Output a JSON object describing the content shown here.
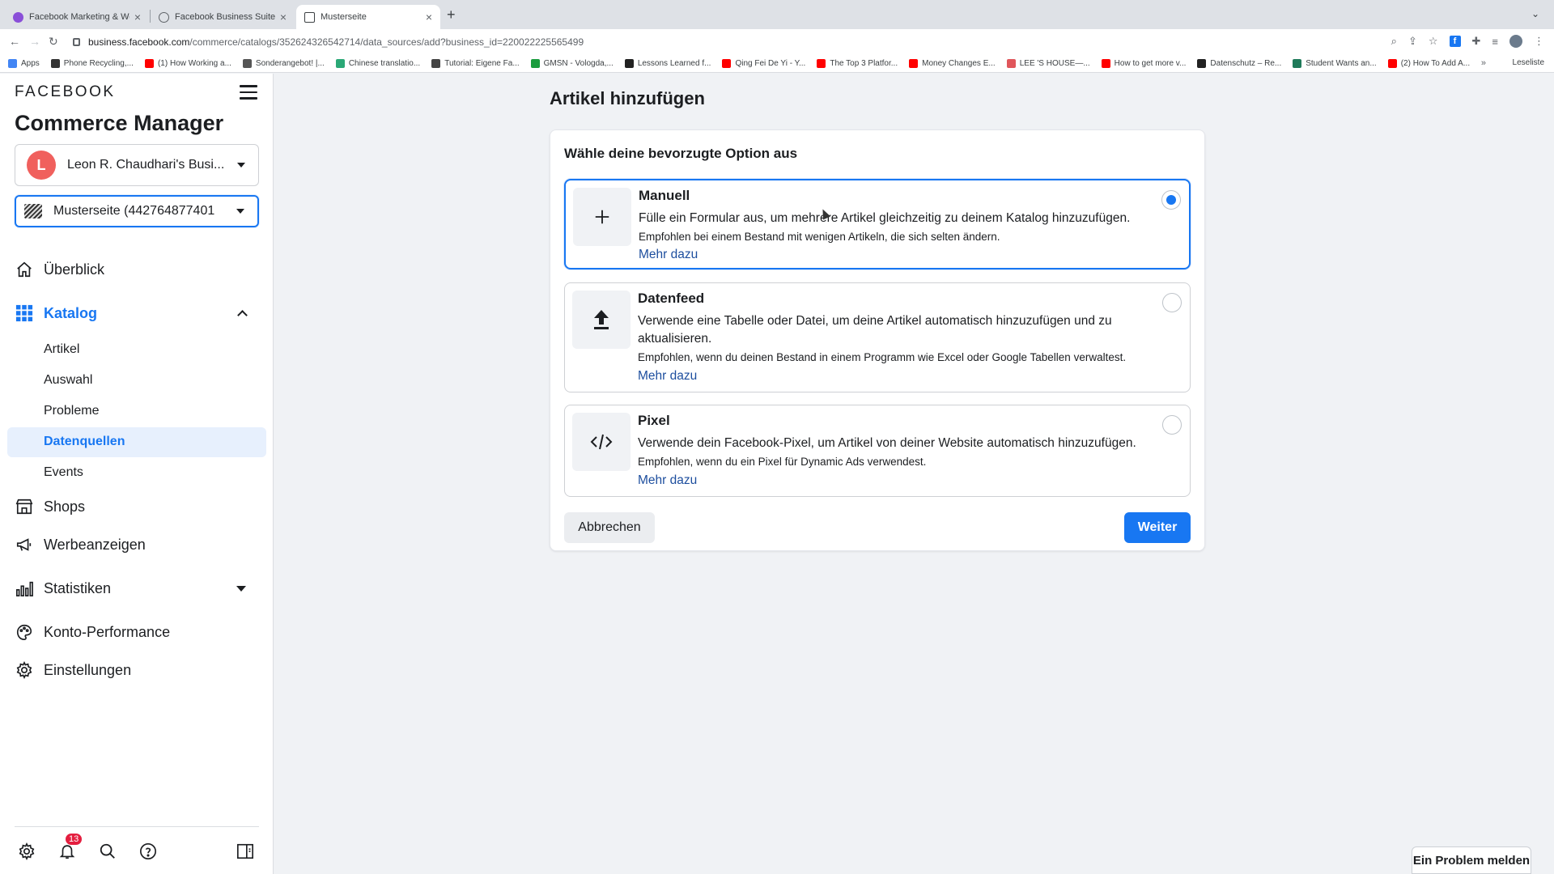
{
  "browser": {
    "tabs": [
      {
        "title": "Facebook Marketing & Werbe",
        "color": "#8a4fd8"
      },
      {
        "title": "Facebook Business Suite",
        "color": "#5f6368"
      },
      {
        "title": "Musterseite",
        "color": "#3c4043"
      }
    ],
    "url_host": "business.facebook.com",
    "url_path": "/commerce/catalogs/352624326542714/data_sources/add?business_id=220022225565499",
    "bookmarks": [
      {
        "label": "Apps",
        "color": "#4285f4"
      },
      {
        "label": "Phone Recycling,...",
        "color": "#333333"
      },
      {
        "label": "(1) How Working a...",
        "color": "#ff0000"
      },
      {
        "label": "Sonderangebot! |...",
        "color": "#555555"
      },
      {
        "label": "Chinese translatio...",
        "color": "#2aa876"
      },
      {
        "label": "Tutorial: Eigene Fa...",
        "color": "#444444"
      },
      {
        "label": "GMSN - Vologda,...",
        "color": "#1a9c3e"
      },
      {
        "label": "Lessons Learned f...",
        "color": "#222222"
      },
      {
        "label": "Qing Fei De Yi - Y...",
        "color": "#ff0000"
      },
      {
        "label": "The Top 3 Platfor...",
        "color": "#ff0000"
      },
      {
        "label": "Money Changes E...",
        "color": "#ff0000"
      },
      {
        "label": "LEE 'S HOUSE—...",
        "color": "#e0565b"
      },
      {
        "label": "How to get more v...",
        "color": "#ff0000"
      },
      {
        "label": "Datenschutz – Re...",
        "color": "#222222"
      },
      {
        "label": "Student Wants an...",
        "color": "#1f7a5a"
      },
      {
        "label": "(2) How To Add A...",
        "color": "#ff0000"
      }
    ],
    "bookmarks_more": "»",
    "reading_list": "Leseliste"
  },
  "sidebar": {
    "logo": "FACEBOOK",
    "title": "Commerce Manager",
    "business_selector": {
      "initial": "L",
      "label": "Leon R. Chaudhari's Busi..."
    },
    "page_selector": {
      "label": "Musterseite (442764877401..."
    },
    "nav": [
      {
        "label": "Überblick"
      },
      {
        "label": "Katalog"
      },
      {
        "label": "Shops"
      },
      {
        "label": "Werbeanzeigen"
      },
      {
        "label": "Statistiken"
      },
      {
        "label": "Konto-Performance"
      },
      {
        "label": "Einstellungen"
      }
    ],
    "catalog_sub": [
      {
        "label": "Artikel"
      },
      {
        "label": "Auswahl"
      },
      {
        "label": "Probleme"
      },
      {
        "label": "Datenquellen"
      },
      {
        "label": "Events"
      }
    ],
    "notifications_count": "13"
  },
  "main": {
    "page_title": "Artikel hinzufügen",
    "card_heading": "Wähle deine bevorzugte Option aus",
    "options": [
      {
        "title": "Manuell",
        "description": "Fülle ein Formular aus, um mehrere Artikel gleichzeitig zu deinem Katalog hinzuzufügen.",
        "hint": "Empfohlen bei einem Bestand mit wenigen Artikeln, die sich selten ändern.",
        "link": "Mehr dazu",
        "selected": true
      },
      {
        "title": "Datenfeed",
        "description": "Verwende eine Tabelle oder Datei, um deine Artikel automatisch hinzuzufügen und zu aktualisieren.",
        "hint": "Empfohlen, wenn du deinen Bestand in einem Programm wie Excel oder Google Tabellen verwaltest.",
        "link": "Mehr dazu",
        "selected": false
      },
      {
        "title": "Pixel",
        "description": "Verwende dein Facebook-Pixel, um Artikel von deiner Website automatisch hinzuzufügen.",
        "hint": "Empfohlen, wenn du ein Pixel für Dynamic Ads verwendest.",
        "link": "Mehr dazu",
        "selected": false
      }
    ],
    "cancel_label": "Abbrechen",
    "next_label": "Weiter"
  },
  "report_label": "Ein Problem melden",
  "colors": {
    "accent": "#1877f2",
    "link": "#1d4e9e",
    "selected_bg": "#e7f0fd"
  }
}
